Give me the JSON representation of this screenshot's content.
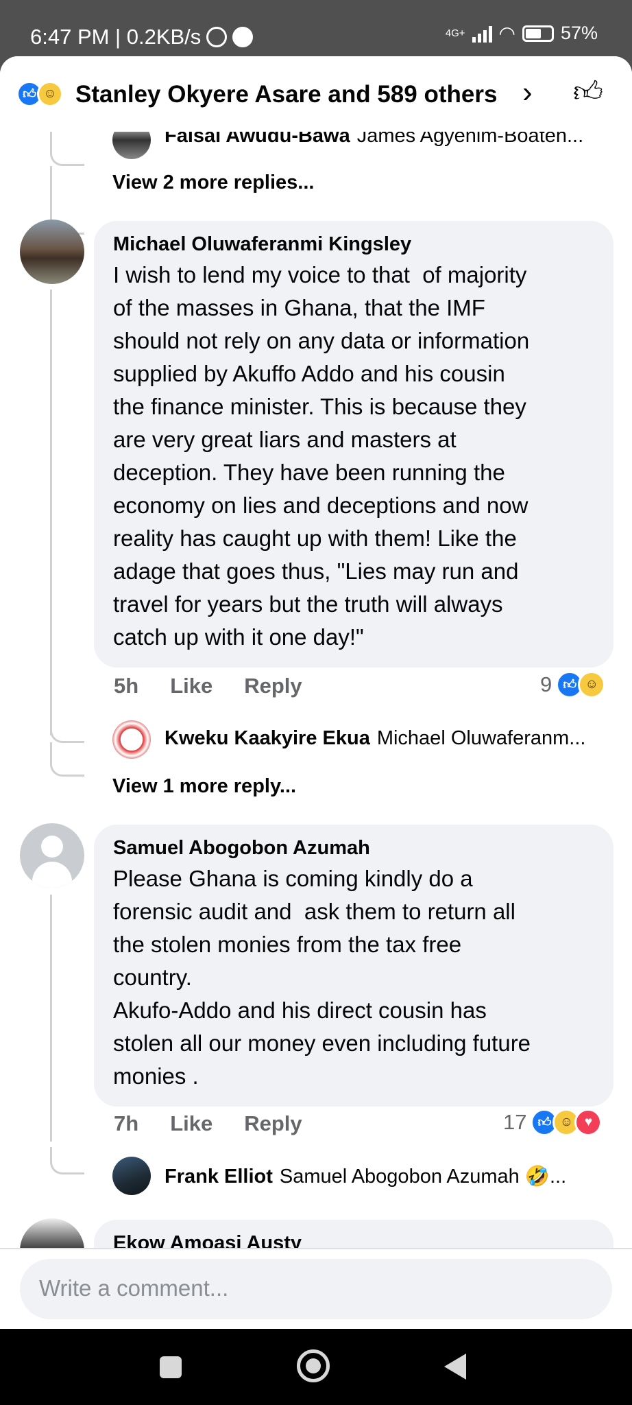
{
  "status_bar": {
    "time_speed": "6:47 PM | 0.2KB/s",
    "network": "4G+",
    "battery": "57%"
  },
  "reactions_header": {
    "text": "Stanley Okyere Asare and 589 others",
    "chevron": "›",
    "icons": [
      "like-icon",
      "haha-icon",
      "like-outline-icon"
    ]
  },
  "thread_top": {
    "reply_preview": {
      "name": "Faisal Awudu-Bawa",
      "text": "James Agyenim-Boaten..."
    },
    "view_more": "View 2 more replies..."
  },
  "comments": [
    {
      "author": "Michael Oluwaferanmi Kingsley",
      "text": "I wish to lend my voice to that  of majority\nof the masses in Ghana, that the IMF\nshould not rely on any data or information\nsupplied by Akuffo Addo and his cousin\nthe finance minister. This is because they\nare very great liars and masters at\ndeception. They have been running the\neconomy on lies and deceptions and now\nreality has caught up with them! Like the\nadage that goes thus, \"Lies may run and\ntravel for years but the truth will always\ncatch up with it one day!\"",
      "time": "5h",
      "like_label": "Like",
      "reply_label": "Reply",
      "reaction_count": "9",
      "reply_preview": {
        "name": "Kweku Kaakyire Ekua",
        "text": "Michael Oluwaferanm..."
      },
      "view_more": "View 1 more reply..."
    },
    {
      "author": "Samuel Abogobon Azumah",
      "text": "Please Ghana is coming kindly do a\nforensic audit and  ask them to return all\nthe stolen monies from the tax free\ncountry.\nAkufo-Addo and his direct cousin has\nstolen all our money even including future\nmonies .",
      "time": "7h",
      "like_label": "Like",
      "reply_label": "Reply",
      "reaction_count": "17",
      "reply_preview": {
        "name": "Frank Elliot",
        "text": "Samuel Abogobon Azumah 🤣..."
      }
    },
    {
      "author": "Ekow Amoasi Austy"
    }
  ],
  "composer": {
    "placeholder": "Write a comment..."
  }
}
